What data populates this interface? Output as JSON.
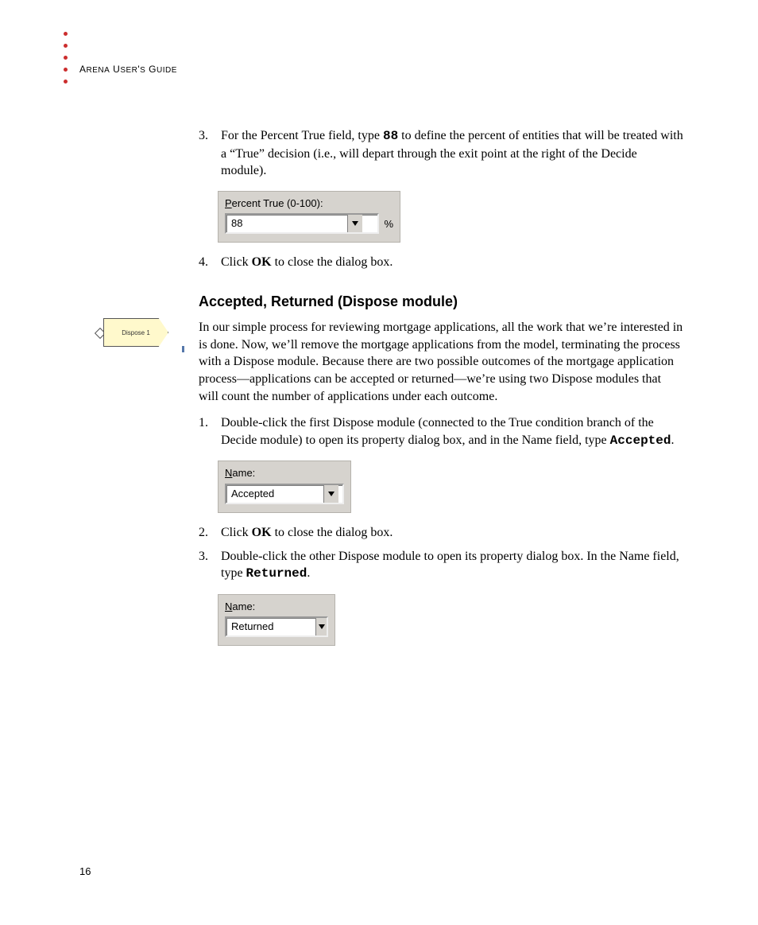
{
  "header": {
    "title_part1": "A",
    "title_part2": "RENA",
    "title_part3": " U",
    "title_part4": "SER",
    "title_part5": "'",
    "title_part6": "S",
    "title_part7": " G",
    "title_part8": "UIDE"
  },
  "step3": {
    "num": "3.",
    "text_a": "For the Percent True field, type ",
    "code": "88",
    "text_b": " to define the percent of entities that will be treated with a “True” decision (i.e., will depart through the exit point at the right of the Decide module)."
  },
  "dlg_percent": {
    "label_u": "P",
    "label_rest": "ercent True (0-100):",
    "value": "88",
    "suffix": "%"
  },
  "step4": {
    "num": "4.",
    "text_a": "Click ",
    "bold": "OK",
    "text_b": " to close the dialog box."
  },
  "section_heading": "Accepted, Returned (Dispose module)",
  "dispose_icon_label": "Dispose 1",
  "intro_para": "In our simple process for reviewing mortgage applications, all the work that we’re interested in is done. Now, we’ll remove the mortgage applications from the model, terminating the process with a Dispose module. Because there are two possible outcomes of the mortgage application process—applications can be accepted or returned—we’re using two Dispose modules that will count the number of applications under each outcome.",
  "dstep1": {
    "num": "1.",
    "text_a": "Double-click the first Dispose module (connected to the True condition branch of the Decide module) to open its property dialog box, and in the Name field, type ",
    "code": "Accepted",
    "text_b": "."
  },
  "dlg_name1": {
    "label_u": "N",
    "label_rest": "ame:",
    "value": "Accepted"
  },
  "dstep2": {
    "num": "2.",
    "text_a": "Click ",
    "bold": "OK",
    "text_b": " to close the dialog box."
  },
  "dstep3": {
    "num": "3.",
    "text_a": "Double-click the other Dispose module to open its property dialog box. In the Name field, type ",
    "code": "Returned",
    "text_b": "."
  },
  "dlg_name2": {
    "label_u": "N",
    "label_rest": "ame:",
    "value": "Returned"
  },
  "page_number": "16"
}
